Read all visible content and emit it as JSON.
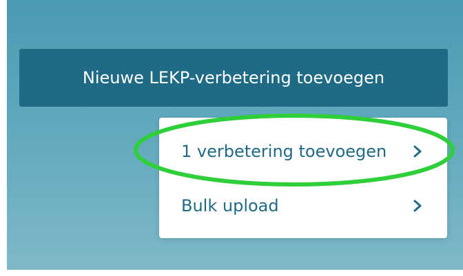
{
  "main_button": {
    "label": "Nieuwe LEKP-verbetering toevoegen"
  },
  "menu": {
    "items": [
      {
        "label": "1 verbetering toevoegen",
        "icon": "chevron-right-icon"
      },
      {
        "label": "Bulk upload",
        "icon": "chevron-right-icon"
      }
    ]
  },
  "colors": {
    "accent": "#1f6a85",
    "highlight": "#2fcf3a"
  }
}
